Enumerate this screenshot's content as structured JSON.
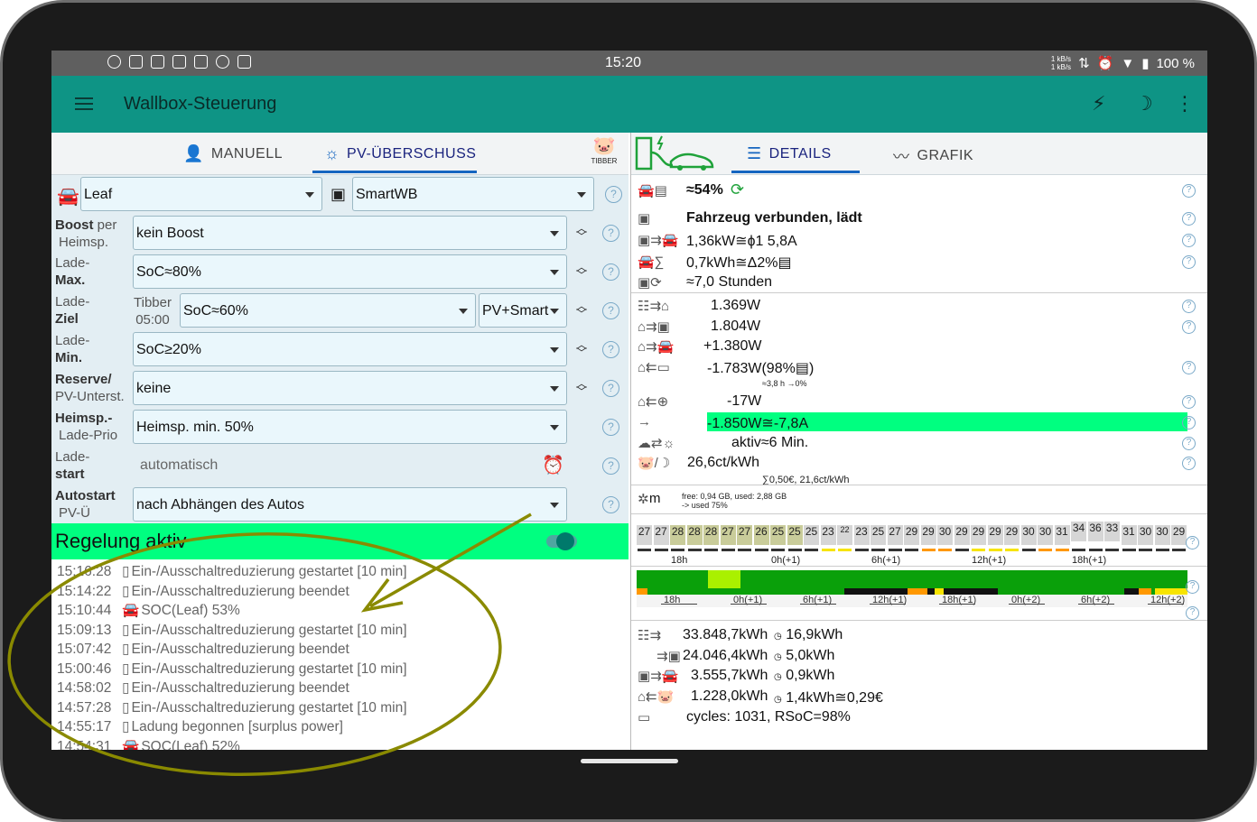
{
  "status": {
    "time": "15:20",
    "battery": "100 %",
    "speed_up": "1 kB/s",
    "speed_down": "1 kB/s"
  },
  "app": {
    "title": "Wallbox-Steuerung"
  },
  "tabs_left": {
    "manuell": "MANUELL",
    "pv": "PV-ÜBERSCHUSS",
    "tibber": "TIBBER"
  },
  "tabs_right": {
    "details": "DETAILS",
    "grafik": "GRAFIK"
  },
  "controls": {
    "car": "Leaf",
    "wallbox": "SmartWB",
    "boost_label_bold": "Boost",
    "boost_label_rest": " per",
    "boost_label_2": "Heimsp.",
    "boost_value": "kein Boost",
    "lademax_label_1": "Lade-",
    "lademax_label_2": "Max.",
    "lademax_value": "SoC≈80%",
    "ladeziel_label_1": "Lade-",
    "ladeziel_label_2": "Ziel",
    "tibber_label": "Tibber",
    "tibber_time": "05:00",
    "ladeziel_value": "SoC≈60%",
    "ladeziel_mode": "PV+Smart",
    "lademin_label_1": "Lade-",
    "lademin_label_2": "Min.",
    "lademin_value": "SoC≥20%",
    "reserve_label_1": "Reserve/",
    "reserve_label_2": "PV-Unterst.",
    "reserve_value": "keine",
    "prio_label_1": "Heimsp.-",
    "prio_label_2": "Lade-Prio",
    "prio_value": "Heimsp. min. 50%",
    "ladestart_label_1": "Lade-",
    "ladestart_label_2": "start",
    "ladestart_value": "automatisch",
    "autostart_label_1": "Autostart",
    "autostart_label_2": "PV-Ü",
    "autostart_value": "nach Abhängen des Autos"
  },
  "regelung": "Regelung aktiv",
  "log": [
    {
      "time": "15:16:28",
      "text": "Ein-/Ausschaltreduzierung gestartet [10 min]"
    },
    {
      "time": "15:14:22",
      "text": "Ein-/Ausschaltreduzierung beendet"
    },
    {
      "time": "15:10:44",
      "text": "SOC(Leaf) 53%"
    },
    {
      "time": "15:09:13",
      "text": "Ein-/Ausschaltreduzierung gestartet [10 min]"
    },
    {
      "time": "15:07:42",
      "text": "Ein-/Ausschaltreduzierung beendet"
    },
    {
      "time": "15:00:46",
      "text": "Ein-/Ausschaltreduzierung gestartet [10 min]"
    },
    {
      "time": "14:58:02",
      "text": "Ein-/Ausschaltreduzierung beendet"
    },
    {
      "time": "14:57:28",
      "text": "Ein-/Ausschaltreduzierung gestartet [10 min]"
    },
    {
      "time": "14:55:17",
      "text": "Ladung begonnen [surplus power]"
    },
    {
      "time": "14:54:31",
      "text": "SOC(Leaf) 52%"
    }
  ],
  "details": {
    "soc": "≈54%",
    "status": "Fahrzeug verbunden, lädt",
    "power": "1,36kW≅ɸ1 5,8A",
    "energy": "0,7kWh≅Δ2%▤",
    "duration": "≈7,0 Stunden",
    "pv_home": "1.369W",
    "home_wb": "1.804W",
    "home_car": "+1.380W",
    "home_batt": "-1.783W(98%▤)",
    "batt_sub": "≈3,8 h →0%",
    "home_grid": "-17W",
    "surplus": "-1.850W≅-7,8A",
    "pv_status": "aktiv≈6 Min.",
    "price": "26,6ct/kWh",
    "price_sub": "∑0,50€, 21,6ct/kWh",
    "mem_1": "free: 0,94 GB, used: 2,88 GB",
    "mem_2": "-> used 75%",
    "mem_unit": "m"
  },
  "prices": [
    "27",
    "27",
    "28",
    "28",
    "28",
    "27",
    "27",
    "26",
    "25",
    "25",
    "25",
    "23",
    "22",
    "23",
    "25",
    "27",
    "29",
    "29",
    "30",
    "29",
    "29",
    "29",
    "29",
    "30",
    "30",
    "31",
    "34",
    "36",
    "33",
    "31",
    "30",
    "30",
    "29"
  ],
  "price_ticks": [
    "18h",
    "0h(+1)",
    "6h(+1)",
    "12h(+1)",
    "18h(+1)"
  ],
  "strip_ticks": [
    "18h",
    "0h(+1)",
    "6h(+1)",
    "12h(+1)",
    "18h(+1)",
    "0h(+2)",
    "6h(+2)",
    "12h(+2)"
  ],
  "totals": {
    "pv_total": "33.848,7kWh",
    "pv_day": "16,9kWh",
    "wb_total": "24.046,4kWh",
    "wb_day": "5,0kWh",
    "car_total": "3.555,7kWh",
    "car_day": "0,9kWh",
    "grid_total": "1.228,0kWh",
    "grid_day": "1,4kWh≅0,29€",
    "cycles": "cycles: 1031, RSoC=98%"
  },
  "colors": {
    "appbar": "#0e9485",
    "accent": "#1565c0",
    "active_green": "#00ff80",
    "annotation": "#8a8a00"
  }
}
